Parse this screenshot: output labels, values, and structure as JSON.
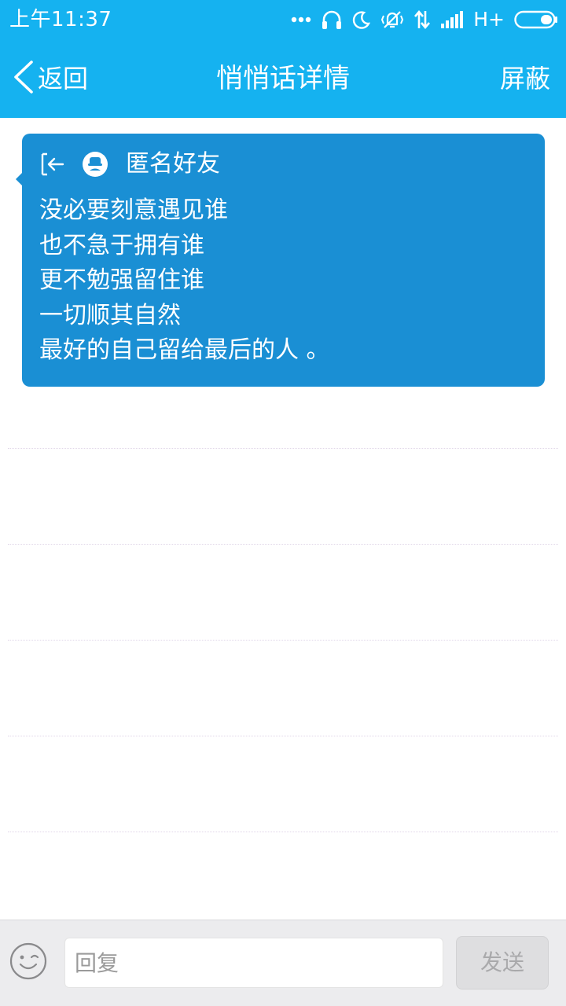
{
  "status_bar": {
    "time": "上午11:37",
    "network": "H+",
    "icons": [
      "more-dots-icon",
      "headphones-icon",
      "moon-icon",
      "vibrate-icon",
      "data-arrows-icon",
      "signal-icon",
      "battery-icon"
    ]
  },
  "nav": {
    "back_label": "返回",
    "title": "悄悄话详情",
    "right_action": "屏蔽"
  },
  "message": {
    "sender": "匿名好友",
    "lines": [
      "没必要刻意遇见谁",
      "也不急于拥有谁",
      "更不勉强留住谁",
      "一切顺其自然",
      "最好的自己留给最后的人 。"
    ]
  },
  "input_bar": {
    "placeholder": "回复",
    "send_label": "发送"
  },
  "colors": {
    "header": "#15b2f0",
    "bubble": "#1a8fd4",
    "input_bar_bg": "#ececee",
    "send_disabled": "#dedee0"
  }
}
